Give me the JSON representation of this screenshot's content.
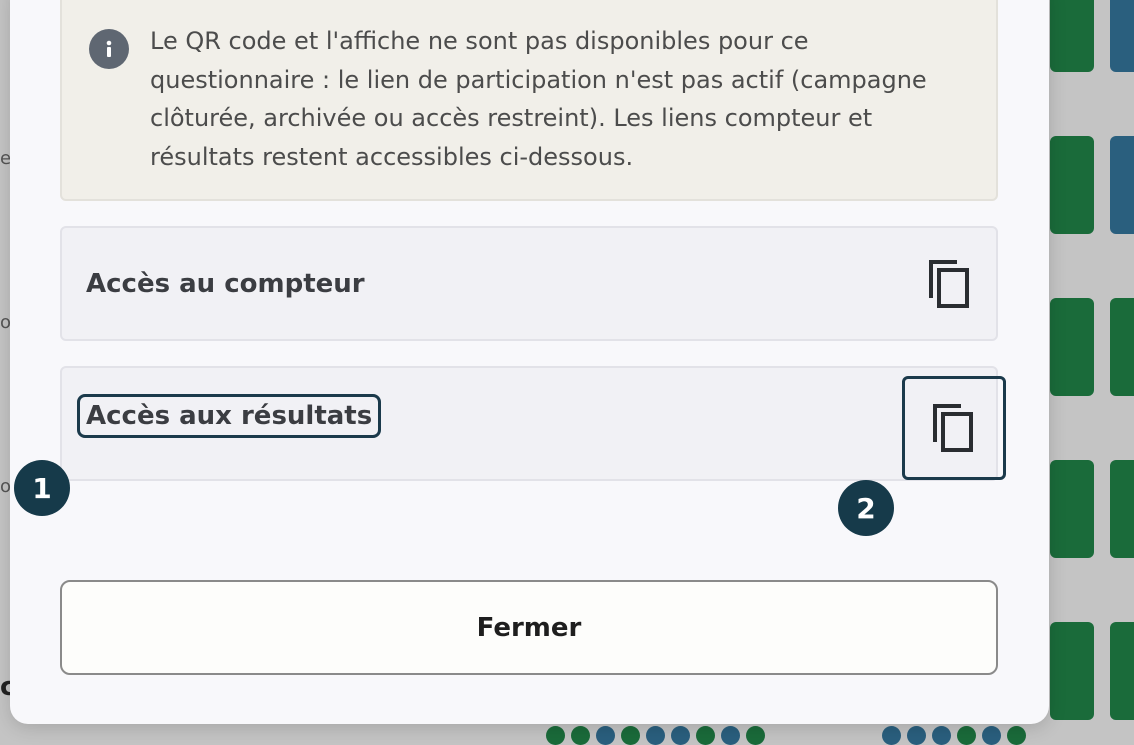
{
  "background": {
    "left_partial_letters": [
      "e",
      "o",
      "o",
      "c"
    ]
  },
  "modal": {
    "info_message": "Le QR code et l'affiche ne sont pas disponibles pour ce questionnaire : le lien de participation n'est pas actif (campagne clôturée, archivée ou accès restreint). Les liens compteur et résultats restent accessibles ci-dessous.",
    "counter_link_label": "Accès au compteur",
    "results_link_label": "Accès aux résultats",
    "close_label": "Fermer"
  },
  "annotations": {
    "badge_1": "1",
    "badge_2": "2"
  },
  "colors": {
    "accent_dark": "#163a4a",
    "bar_green": "#1a6b3a",
    "bar_blue": "#2a5f7e"
  }
}
